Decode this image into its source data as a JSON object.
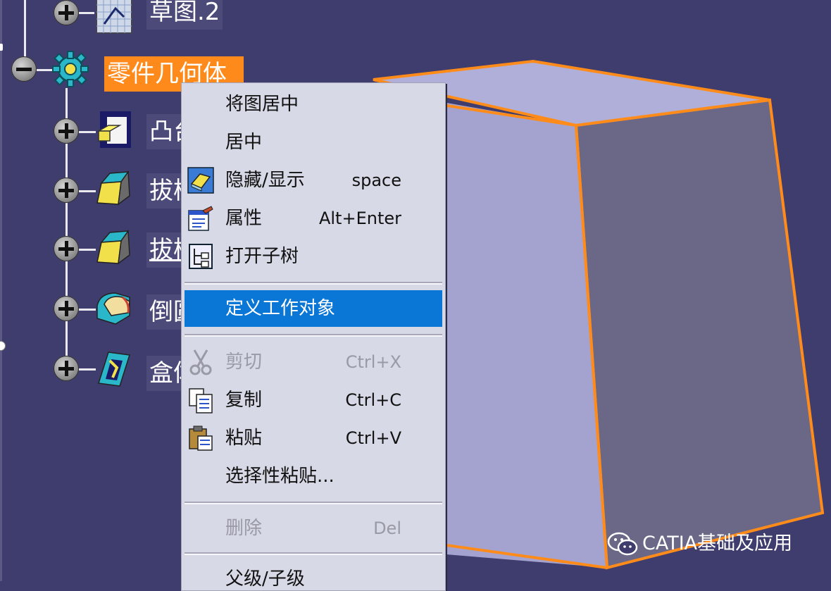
{
  "tree": {
    "items": [
      {
        "label": "草图.2"
      },
      {
        "label": "零件几何体"
      },
      {
        "label": "凸台"
      },
      {
        "label": "拔模"
      },
      {
        "label": "拔模"
      },
      {
        "label": "倒圆"
      },
      {
        "label": "盒体"
      }
    ]
  },
  "menu": {
    "items": [
      {
        "label": "将图居中",
        "shortcut": ""
      },
      {
        "label": "居中",
        "shortcut": ""
      },
      {
        "label": "隐藏/显示",
        "shortcut": "space"
      },
      {
        "label": "属性",
        "shortcut": "Alt+Enter"
      },
      {
        "label": "打开子树",
        "shortcut": ""
      },
      {
        "label": "定义工作对象",
        "shortcut": ""
      },
      {
        "label": "剪切",
        "shortcut": "Ctrl+X"
      },
      {
        "label": "复制",
        "shortcut": "Ctrl+C"
      },
      {
        "label": "粘贴",
        "shortcut": "Ctrl+V"
      },
      {
        "label": "选择性粘贴...",
        "shortcut": ""
      },
      {
        "label": "删除",
        "shortcut": "Del"
      },
      {
        "label": "父级/子级",
        "shortcut": ""
      }
    ]
  },
  "watermark": {
    "text": "CATIA基础及应用",
    "icon": "wechat-icon"
  },
  "colors": {
    "background": "#3f3d6d",
    "selection": "#ff8a1c",
    "menu_highlight": "#0a76d6",
    "solid_front": "#a4a3cf",
    "solid_side": "#6a6886",
    "solid_edge": "#ff8c1a"
  }
}
